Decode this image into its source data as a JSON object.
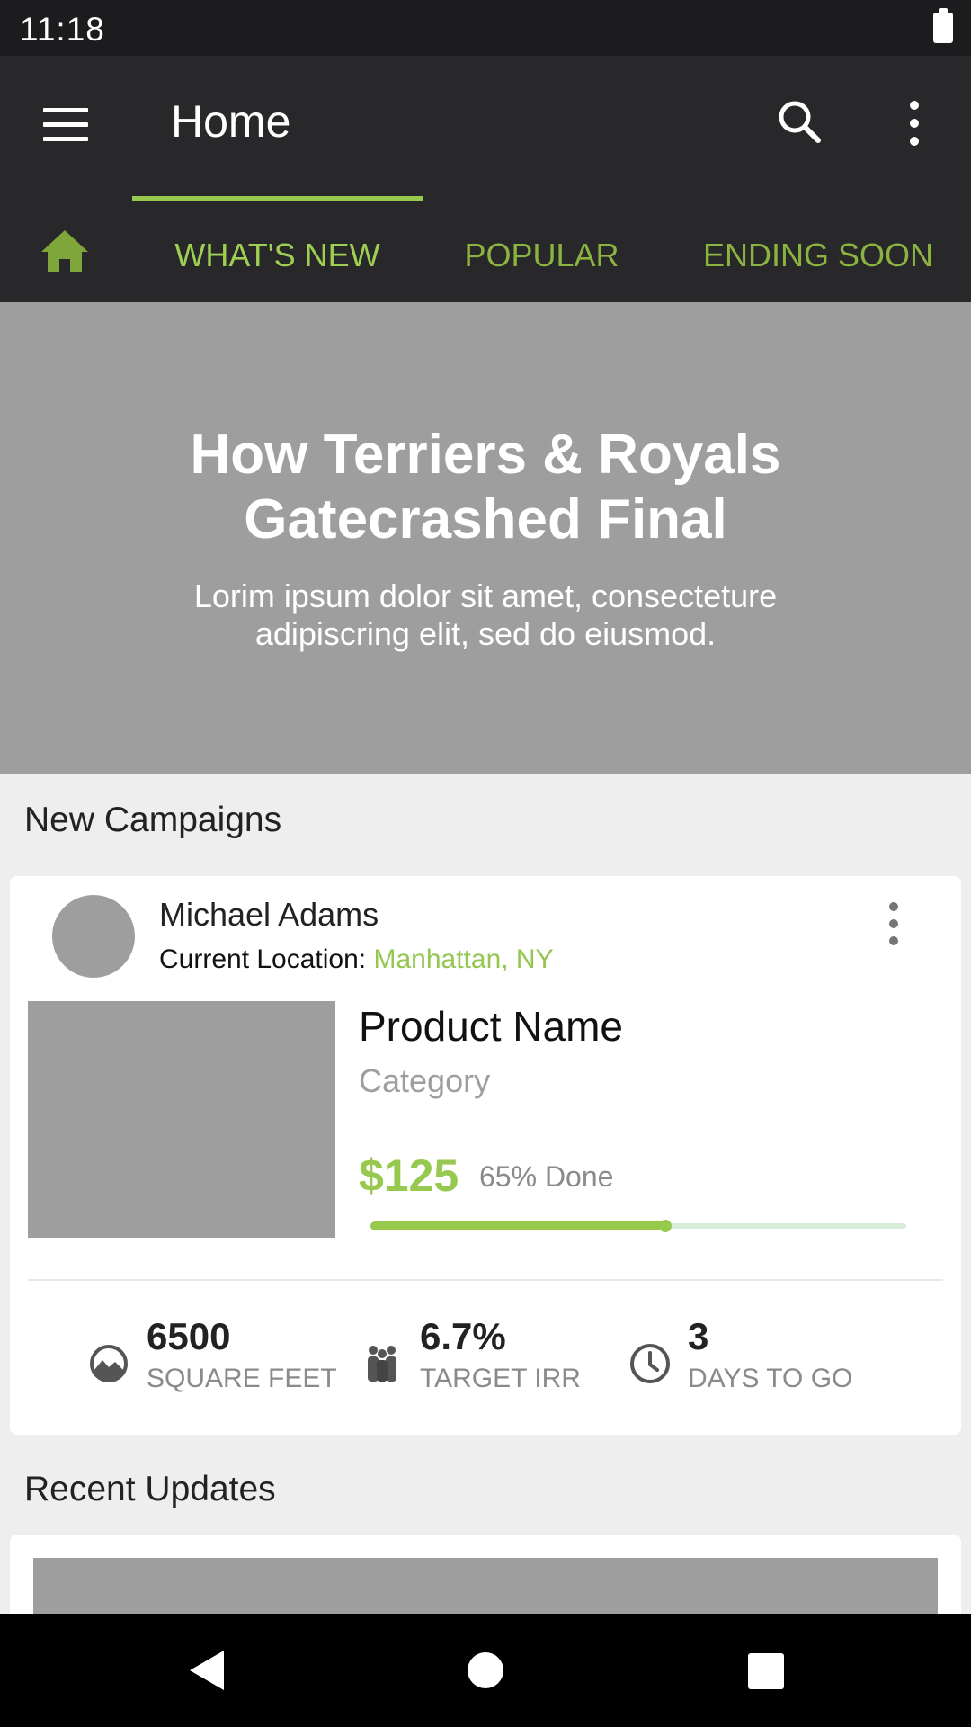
{
  "status_bar": {
    "time": "11:18"
  },
  "app_bar": {
    "title": "Home"
  },
  "tabs": [
    {
      "label": "WHAT'S NEW",
      "active": true
    },
    {
      "label": "POPULAR",
      "active": false
    },
    {
      "label": "ENDING SOON",
      "active": false
    }
  ],
  "hero": {
    "title": "How Terriers & Royals Gatecrashed Final",
    "subtitle": "Lorim ipsum dolor sit amet, consecteture adipiscring elit, sed do eiusmod."
  },
  "sections": {
    "new_campaigns": "New Campaigns",
    "recent_updates": "Recent Updates"
  },
  "campaign": {
    "user_name": "Michael Adams",
    "location_label": "Current Location:",
    "location_value": "Manhattan, NY",
    "product_name": "Product Name",
    "category": "Category",
    "price": "$125",
    "progress_text": "65% Done",
    "progress_fraction": 0.55,
    "stats": [
      {
        "value": "6500",
        "label": "SQUARE FEET",
        "icon": "landscape-icon"
      },
      {
        "value": "6.7%",
        "label": "TARGET IRR",
        "icon": "people-icon"
      },
      {
        "value": "3",
        "label": "DAYS TO GO",
        "icon": "clock-icon"
      }
    ]
  },
  "colors": {
    "accent": "#96c94c",
    "tab_text": "#8bb340",
    "app_bar": "#28282a",
    "placeholder": "#9e9e9e"
  }
}
